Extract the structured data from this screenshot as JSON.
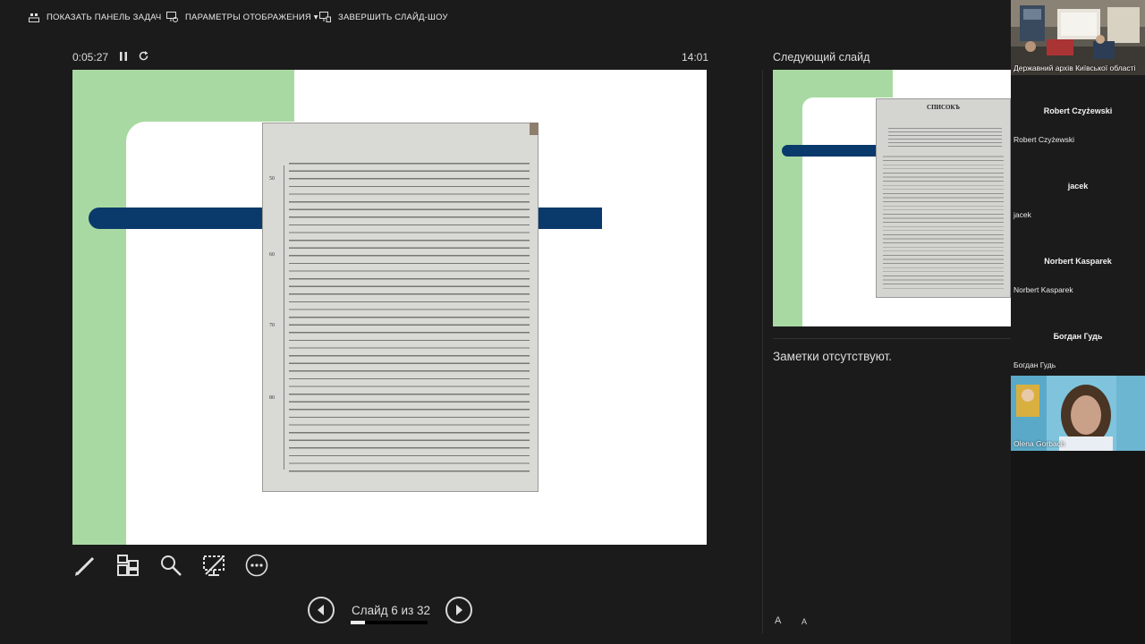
{
  "topbar": {
    "taskbar_label": "ПОКАЗАТЬ ПАНЕЛЬ ЗАДАЧ",
    "display_label": "ПАРАМЕТРЫ ОТОБРАЖЕНИЯ ▾",
    "end_label": "ЗАВЕРШИТЬ СЛАЙД-ШОУ"
  },
  "presenter": {
    "elapsed": "0:05:27",
    "clock": "14:01",
    "next_label": "Следующий слайд",
    "notes": "Заметки отсутствуют.",
    "font_grow": "A",
    "font_shrink": "A"
  },
  "navigation": {
    "slide_label": "Слайд 6 из 32",
    "current": 6,
    "total": 32
  },
  "slide": {
    "doc_line_numbers": [
      "50",
      "60",
      "70",
      "80"
    ]
  },
  "next_slide": {
    "doc_heading": "СПИСОКЪ"
  },
  "participants": [
    {
      "type": "video",
      "name": "Державний архів Київської області"
    },
    {
      "type": "tile",
      "display": "Robert Czyżewski",
      "name": "Robert Czyżewski"
    },
    {
      "type": "tile",
      "display": "jacek",
      "name": "jacek"
    },
    {
      "type": "tile",
      "display": "Norbert Kasparek",
      "name": "Norbert Kasparek"
    },
    {
      "type": "tile",
      "display": "Богдан Гудь",
      "name": "Богдан Гудь"
    },
    {
      "type": "video",
      "name": "Olena Gorbach"
    }
  ],
  "colors": {
    "background": "#1b1b1b",
    "slide_green": "#a9d9a2",
    "slide_bar": "#0a3a6b"
  },
  "icons": [
    "taskbar-icon",
    "display-settings-icon",
    "end-show-icon",
    "pause-icon",
    "reset-icon",
    "pen-icon",
    "all-slides-icon",
    "zoom-icon",
    "black-screen-icon",
    "more-options-icon",
    "previous-arrow-icon",
    "next-arrow-icon"
  ]
}
